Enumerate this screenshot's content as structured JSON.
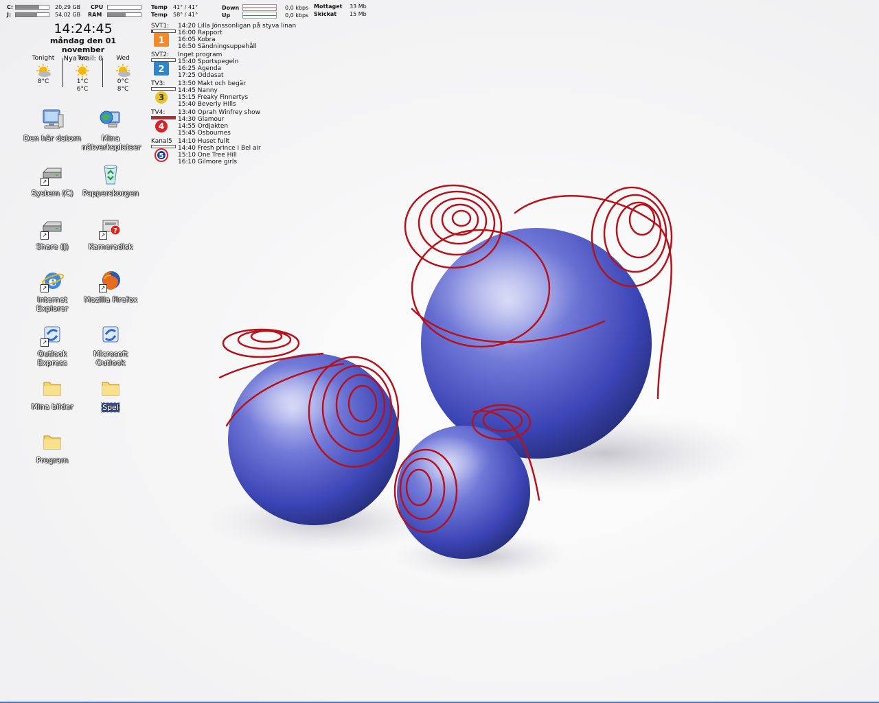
{
  "system_monitor": {
    "drives": [
      {
        "label": "C:",
        "size": "20,29 GB",
        "level": 0.7
      },
      {
        "label": "J:",
        "size": "54,02 GB",
        "level": 0.65
      }
    ],
    "cpu": {
      "label": "CPU",
      "level": 0.0
    },
    "ram": {
      "label": "RAM",
      "level": 0.55
    },
    "temps": [
      {
        "label": "Temp",
        "value": "41° / 41°"
      },
      {
        "label": "Temp",
        "value": "58° / 41°"
      }
    ],
    "network": {
      "down": {
        "label": "Down",
        "speed": "0,0 kbps",
        "color": "#d02a2a"
      },
      "up": {
        "label": "Up",
        "speed": "0,0 kbps",
        "color": "#2a9a3a"
      }
    },
    "totals": [
      {
        "label": "Mottaget",
        "value": "33 Mb"
      },
      {
        "label": "Skickat",
        "value": "15 Mb"
      }
    ]
  },
  "clock": {
    "time": "14:24:45",
    "date": "måndag den 01 november",
    "mail": "Nya mail: 0"
  },
  "weather": [
    {
      "day": "Tonight",
      "icon": "partly-cloudy-icon",
      "temps": "8°C",
      "temps2": ""
    },
    {
      "day": "Tue",
      "icon": "sun-icon",
      "temps": "1°C",
      "temps2": "6°C"
    },
    {
      "day": "Wed",
      "icon": "partly-cloudy-icon",
      "temps": "0°C",
      "temps2": "8°C"
    }
  ],
  "tv_guide": [
    {
      "channel": "SVT1:",
      "logo": "1",
      "logo_color": "#f08a2a",
      "progress": 0.05,
      "programs": [
        "14:20 Lilla Jönssonligan på styva linan",
        "16:00 Rapport",
        "16:05 Kobra",
        "16:50 Sändningsuppehåll"
      ]
    },
    {
      "channel": "SVT2:",
      "logo": "2",
      "logo_color": "#2e86c8",
      "progress": 0.0,
      "programs": [
        "Inget program",
        "15:40 Sportspegeln",
        "16:25 Agenda",
        "17:25 Oddasat"
      ]
    },
    {
      "channel": "TV3:",
      "logo": "3",
      "logo_color": "#e8c62a",
      "progress": 0.0,
      "programs": [
        "13:50 Makt och begär",
        "14:45 Nanny",
        "15:15 Freaky Finnertys",
        "15:40 Beverly Hills"
      ]
    },
    {
      "channel": "TV4:",
      "logo": "4",
      "logo_color": "#d8232a",
      "progress": 1.0,
      "programs": [
        "13:40 Oprah Winfrey show",
        "14:30 Glamour",
        "14:55 Ordjakten",
        "15:45 Osbournes"
      ]
    },
    {
      "channel": "Kanal5",
      "logo": "5",
      "logo_color": "#1a3f8f",
      "progress": 0.0,
      "programs": [
        "14:10 Huset fullt",
        "14:40 Fresh prince i Bel air",
        "15:10 One Tree Hill",
        "16:10 Gilmore girls"
      ]
    }
  ],
  "desktop_icons": [
    {
      "label": "Den här datorn",
      "icon": "my-computer-icon"
    },
    {
      "label": "Mina nätverksplatser",
      "icon": "network-places-icon"
    },
    {
      "label": "System (C)",
      "icon": "drive-shortcut-icon"
    },
    {
      "label": "Papperskorgen",
      "icon": "recycle-bin-icon"
    },
    {
      "label": "Share (J)",
      "icon": "drive-shortcut-icon"
    },
    {
      "label": "Kameradisk",
      "icon": "camera-disk-icon"
    },
    {
      "label": "Internet Explorer",
      "icon": "internet-explorer-icon"
    },
    {
      "label": "Mozilla Firefox",
      "icon": "firefox-icon"
    },
    {
      "label": "Outlook Express",
      "icon": "outlook-express-icon"
    },
    {
      "label": "Microsoft Outlook",
      "icon": "outlook-icon"
    },
    {
      "label": "Mina bilder",
      "icon": "folder-icon"
    },
    {
      "label": "Spel",
      "icon": "folder-icon"
    },
    {
      "label": "Program",
      "icon": "folder-icon"
    }
  ],
  "colors": {
    "accent": "#314f9e",
    "sphere": "#4a55c8",
    "wire": "#b5121b",
    "taskbar_edge": "#4a73c6"
  }
}
